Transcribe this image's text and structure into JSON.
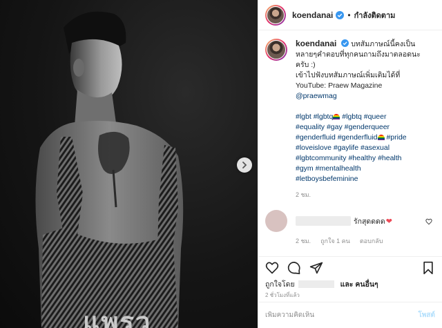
{
  "header": {
    "username": "koendanai",
    "separator": "•",
    "follow_label": "กำลังติดตาม"
  },
  "caption": {
    "username": "koendanai",
    "line1": "บทสัมภาษณ์นี้คงเป็น",
    "line2": "หลายๆคำตอบที่ทุกคนถามถึงมาตลอดนะ",
    "line3": "ครับ :)",
    "line4": "เข้าไปฟังบทสัมภาษณ์เพิ่มเติมได้ที่",
    "line5": "YouTube: Praew Magazine",
    "mention": "@praewmag",
    "hashtags": {
      "h1": "#lgbt",
      "h2": "#lgbtq",
      "h3": "#lgbtq",
      "h4": "#queer",
      "h5": "#equality",
      "h6": "#gay",
      "h7": "#genderqueer",
      "h8": "#genderfluid",
      "h9": "#genderfluid",
      "h10": "#pride",
      "h11": "#loveislove",
      "h12": "#gaylife",
      "h13": "#asexual",
      "h14": "#lgbtcommunity",
      "h15": "#healthy",
      "h16": "#health",
      "h17": "#gym",
      "h18": "#mentalhealth",
      "h19": "#letboysbefeminine"
    },
    "time": "2 ชม."
  },
  "reply": {
    "text": "รักสุดดดด",
    "heart": "❤",
    "time": "2 ชม.",
    "likes": "ถูกใจ 1 คน",
    "reply_label": "ตอบกลับ"
  },
  "likes": {
    "liked_by": "ถูกใจโดย",
    "and_others": "และ คนอื่นๆ"
  },
  "posted_time": "2 ชั่วโมงที่แล้ว",
  "comment_box": {
    "placeholder": "เพิ่มความคิดเห็น",
    "post_label": "โพสต์"
  },
  "photo": {
    "magazine_mark": "แพรว"
  },
  "colors": {
    "verified": "#3897f0",
    "link": "#00376b",
    "muted": "#8e8e8e",
    "post_button": "#b2dffc"
  }
}
